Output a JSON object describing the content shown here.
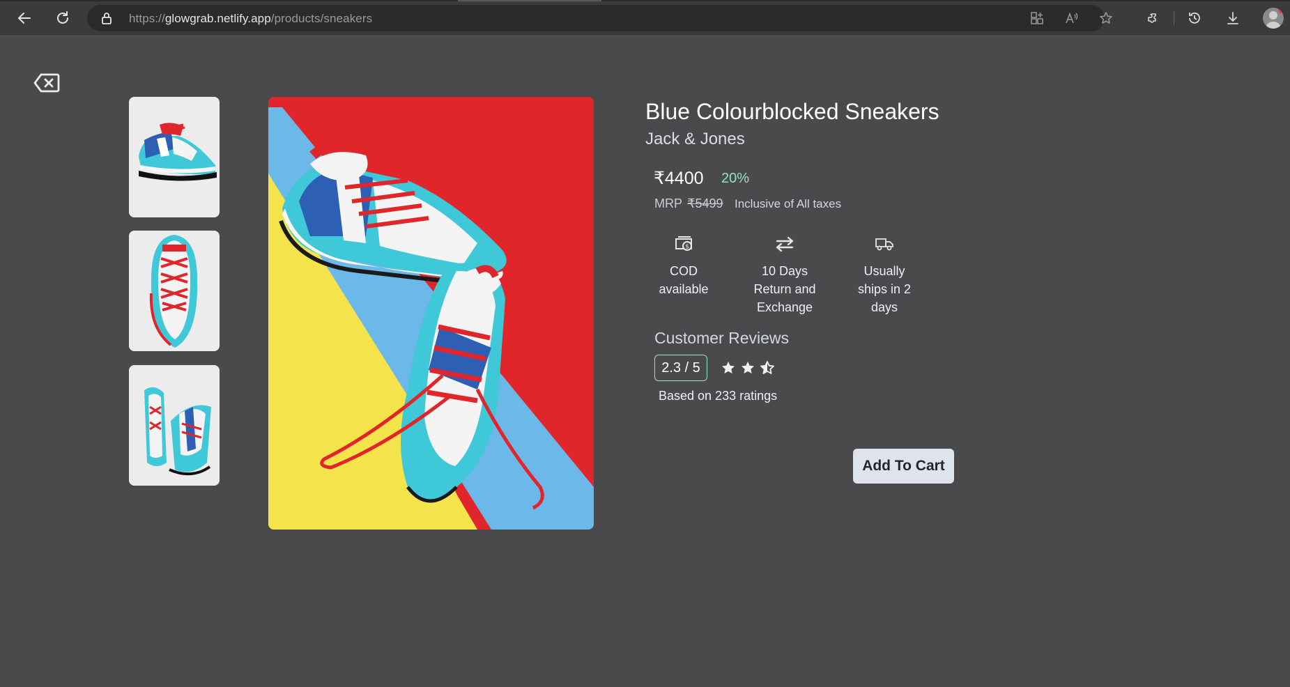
{
  "browser": {
    "url_scheme": "https://",
    "url_host": "glowgrab.netlify.app",
    "url_path": "/products/sneakers"
  },
  "product": {
    "title": "Blue Colourblocked Sneakers",
    "brand": "Jack & Jones",
    "price": "₹4400",
    "discount": "20%",
    "mrp_label": "MRP",
    "mrp_value": "₹5499",
    "tax_note": "Inclusive of All taxes"
  },
  "features": [
    {
      "icon": "cash-icon",
      "line1": "COD",
      "line2": "available",
      "line3": ""
    },
    {
      "icon": "exchange-icon",
      "line1": "10 Days",
      "line2": "Return and",
      "line3": "Exchange"
    },
    {
      "icon": "truck-icon",
      "line1": "Usually",
      "line2": "ships in 2",
      "line3": "days"
    }
  ],
  "reviews": {
    "heading": "Customer Reviews",
    "score": "2.3 / 5",
    "stars": 2.5,
    "based_on": "Based on 233 ratings"
  },
  "actions": {
    "add_to_cart": "Add To Cart"
  },
  "colors": {
    "page_bg": "#4a4a4d",
    "accent": "#8fe3c6",
    "button_bg": "#dfe4ec"
  }
}
